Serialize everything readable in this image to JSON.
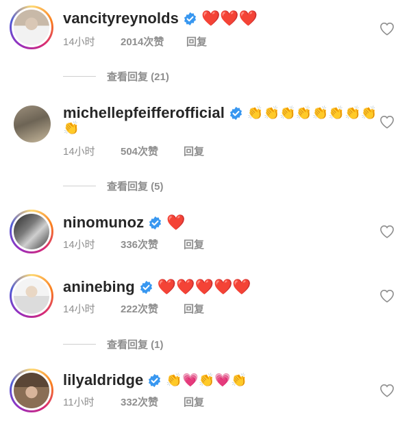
{
  "comments": [
    {
      "username": "vancityreynolds",
      "emojis": [
        "❤️",
        "❤️",
        "❤️"
      ],
      "emojis_cont": [],
      "time": "14小时",
      "likes": "2014次赞",
      "reply": "回复",
      "view_replies": "查看回复 (21)",
      "avatar_style": "ring"
    },
    {
      "username": "michellepfeifferofficial",
      "emojis": [
        "👏",
        "👏",
        "👏",
        "👏",
        "👏",
        "👏",
        "👏",
        "👏"
      ],
      "emojis_cont": [
        "👏"
      ],
      "time": "14小时",
      "likes": "504次赞",
      "reply": "回复",
      "view_replies": "查看回复 (5)",
      "avatar_style": "plain"
    },
    {
      "username": "ninomunoz",
      "emojis": [
        "❤️"
      ],
      "emojis_cont": [],
      "time": "14小时",
      "likes": "336次赞",
      "reply": "回复",
      "view_replies": "",
      "avatar_style": "ring"
    },
    {
      "username": "aninebing",
      "emojis": [
        "❤️",
        "❤️",
        "❤️",
        "❤️",
        "❤️"
      ],
      "emojis_cont": [],
      "time": "14小时",
      "likes": "222次赞",
      "reply": "回复",
      "view_replies": "查看回复 (1)",
      "avatar_style": "ring"
    },
    {
      "username": "lilyaldridge",
      "emojis": [
        "👏",
        "💗",
        "👏",
        "💗",
        "👏"
      ],
      "emojis_cont": [],
      "time": "11小时",
      "likes": "332次赞",
      "reply": "回复",
      "view_replies": "",
      "avatar_style": "ring"
    }
  ],
  "icons": {
    "verified": "verified-badge-icon",
    "like": "heart-outline-icon"
  },
  "colors": {
    "verified_blue": "#3897f0",
    "muted_text": "#8e8e8e",
    "primary_text": "#262626"
  }
}
